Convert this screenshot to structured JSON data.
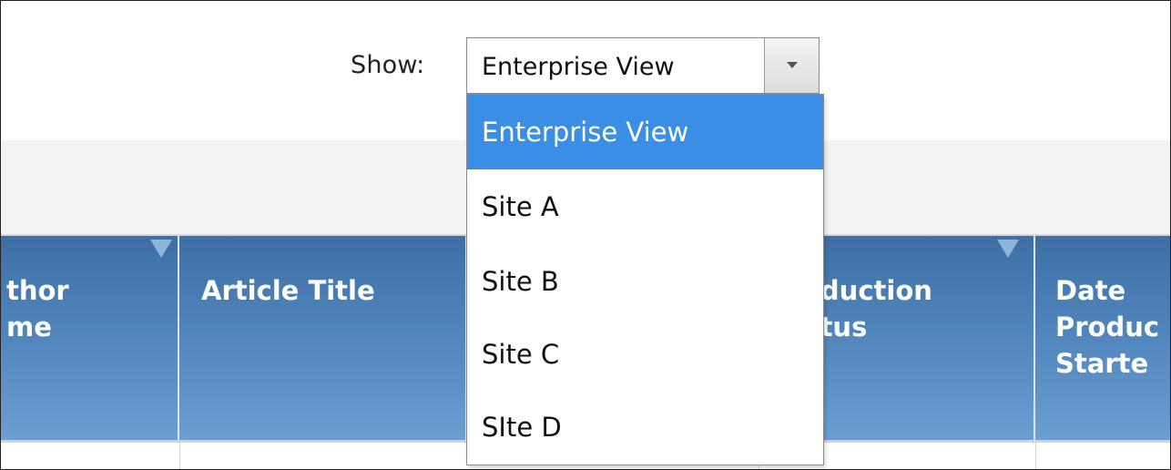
{
  "filter": {
    "label": "Show:",
    "selected": "Enterprise View",
    "options": [
      "Enterprise View",
      "Site A",
      "Site B",
      "Site C",
      "SIte D"
    ],
    "highlighted_index": 0
  },
  "table": {
    "columns": [
      {
        "label": "thor\nme",
        "sortable": true
      },
      {
        "label": "Article Title",
        "sortable": false
      },
      {
        "label": "",
        "sortable": false
      },
      {
        "label": "oduction\natus",
        "sortable": true
      },
      {
        "label": "Date\nProduc\nStarte",
        "sortable": false
      }
    ]
  },
  "colors": {
    "header_top": "#3d6fa5",
    "header_bottom": "#6c9fd2",
    "option_highlight": "#3a8ee6"
  },
  "icons": {
    "select_arrow": "chevron-down-icon",
    "sort_indicator": "sort-down-icon"
  }
}
